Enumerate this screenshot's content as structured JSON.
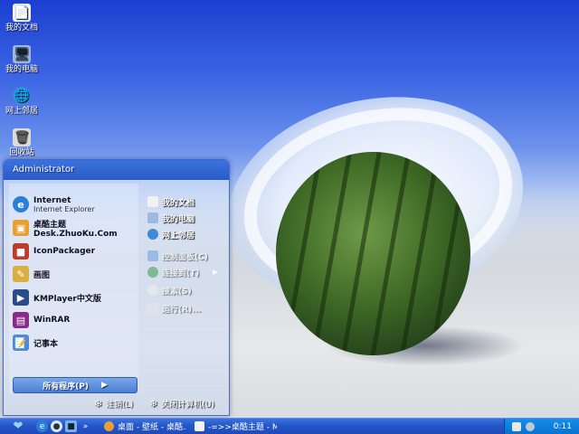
{
  "desktop": {
    "icons": [
      {
        "label": "我的文档",
        "icon": "my-documents-icon"
      },
      {
        "label": "我的电脑",
        "icon": "my-computer-icon"
      },
      {
        "label": "网上邻居",
        "icon": "network-places-icon"
      },
      {
        "label": "回收站",
        "icon": "recycle-bin-icon"
      }
    ]
  },
  "start_menu": {
    "user": "Administrator",
    "pinned": [
      {
        "label": "Internet",
        "sub": "Internet Explorer",
        "icon": "internet-explorer-icon"
      },
      {
        "label": "桌酷主题Desk.ZhuoKu.Com",
        "icon": "zhuoku-icon"
      },
      {
        "label": "IconPackager",
        "icon": "iconpackager-icon"
      },
      {
        "label": "画图",
        "icon": "paint-icon"
      },
      {
        "label": "KMPlayer中文版",
        "icon": "kmplayer-icon"
      },
      {
        "label": "WinRAR",
        "icon": "winrar-icon"
      },
      {
        "label": "记事本",
        "icon": "notepad-icon"
      }
    ],
    "right": [
      {
        "label": "我的文档",
        "icon": "my-documents-icon"
      },
      {
        "label": "我的电脑",
        "icon": "my-computer-icon"
      },
      {
        "label": "网上邻居",
        "icon": "network-places-icon"
      },
      {
        "label": "控制面板(C)",
        "icon": "control-panel-icon"
      },
      {
        "label": "连接到(T)",
        "icon": "connect-to-icon"
      },
      {
        "label": "搜索(S)",
        "icon": "search-icon"
      },
      {
        "label": "运行(R)...",
        "icon": "run-icon"
      }
    ],
    "all_programs": "所有程序(P)",
    "logoff": "注销(L)",
    "shutdown": "关闭计算机(U)"
  },
  "taskbar": {
    "tasks": [
      {
        "label": "桌面 - 壁纸 - 桌酷...",
        "icon": "browser-icon"
      },
      {
        "label": "-=>>桌酷主题 - Mi...",
        "icon": "document-icon"
      }
    ],
    "clock": "0:11"
  },
  "colors": {
    "taskbar": "#2456c8",
    "tray": "#0a6fd0",
    "start_menu_header": "#3a73dc"
  }
}
